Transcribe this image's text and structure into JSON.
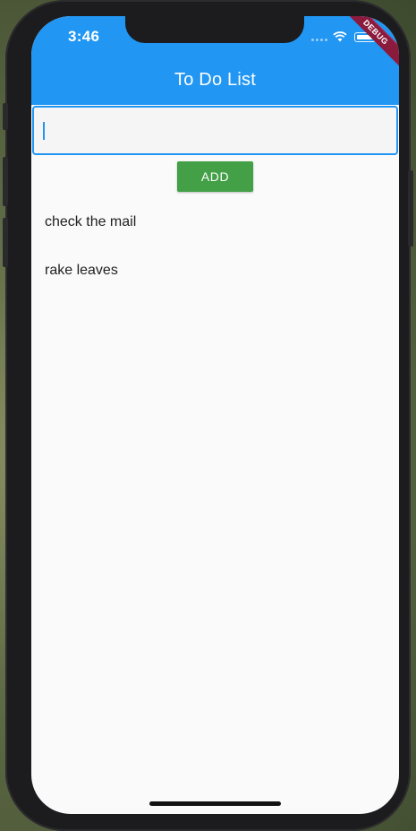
{
  "status_bar": {
    "time": "3:46",
    "icons": [
      "signal-dots-icon",
      "wifi-icon",
      "battery-icon"
    ]
  },
  "debug_banner": "DEBUG",
  "app_bar": {
    "title": "To Do List",
    "color": "#2196f3"
  },
  "input": {
    "value": "",
    "placeholder": "",
    "focus_color": "#2196f3"
  },
  "add_button": {
    "label": "ADD",
    "color": "#43a047"
  },
  "todos": [
    {
      "text": "check the mail"
    },
    {
      "text": "rake leaves"
    }
  ]
}
